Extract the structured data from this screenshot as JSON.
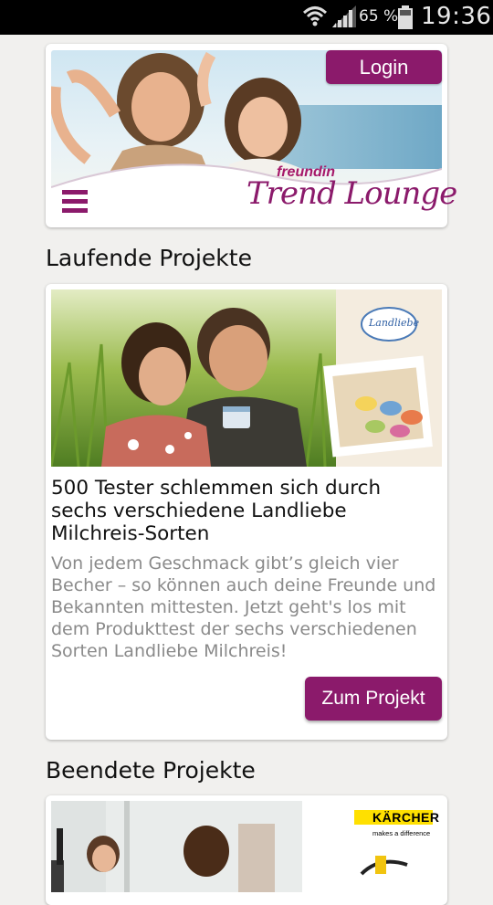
{
  "status_bar": {
    "battery_percent": "65 %",
    "time": "19:36"
  },
  "header": {
    "login_label": "Login",
    "logo_small": "freundin",
    "logo_big": "Trend Lounge"
  },
  "sections": {
    "running_title": "Laufende Projekte",
    "ended_title": "Beendete Projekte"
  },
  "running_project": {
    "brand_logo": "Landliebe",
    "title": "500 Tester schlemmen sich durch sechs verschiedene Landliebe Milchreis-Sorten",
    "description": "Von jedem Geschmack gibt’s gleich vier Becher – so können auch deine Freunde und Bekannten mittesten. Jetzt geht's los mit dem Produkttest der sechs verschiedenen Sorten Landliebe Milchreis!",
    "button_label": "Zum Projekt"
  },
  "ended_project": {
    "brand_logo": "KÄRCHER",
    "brand_slogan": "makes a difference"
  },
  "colors": {
    "accent": "#8b1a6b",
    "background": "#f1f0ee"
  }
}
